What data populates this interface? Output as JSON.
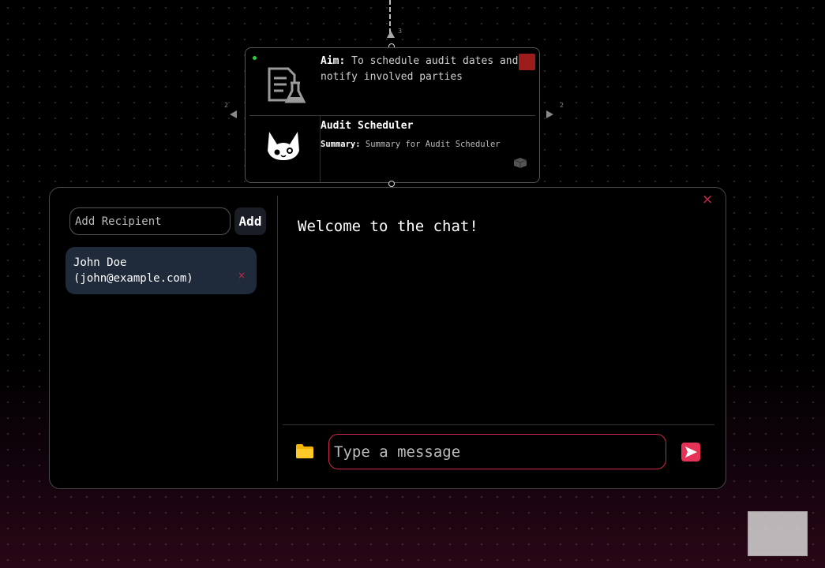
{
  "connector": {
    "top_port_label": "3",
    "left_port_label": "2",
    "right_port_label": "2"
  },
  "node": {
    "aim_label": "Aim:",
    "aim_text": "To schedule audit dates and notify involved parties",
    "title": "Audit Scheduler",
    "summary_label": "Summary:",
    "summary_text": "Summary for Audit Scheduler",
    "icons": [
      "document-science-icon",
      "cat-face-icon",
      "cube-icon"
    ],
    "status_color": "#2ecc40"
  },
  "chat": {
    "recipient_placeholder": "Add Recipient",
    "add_label": "Add",
    "recipients": [
      {
        "display": "John Doe\n(john@example.com)",
        "remove_label": "×"
      }
    ],
    "welcome": "Welcome to the chat!",
    "message_placeholder": "Type a message",
    "close_label": "×",
    "accent_color": "#e63257"
  }
}
